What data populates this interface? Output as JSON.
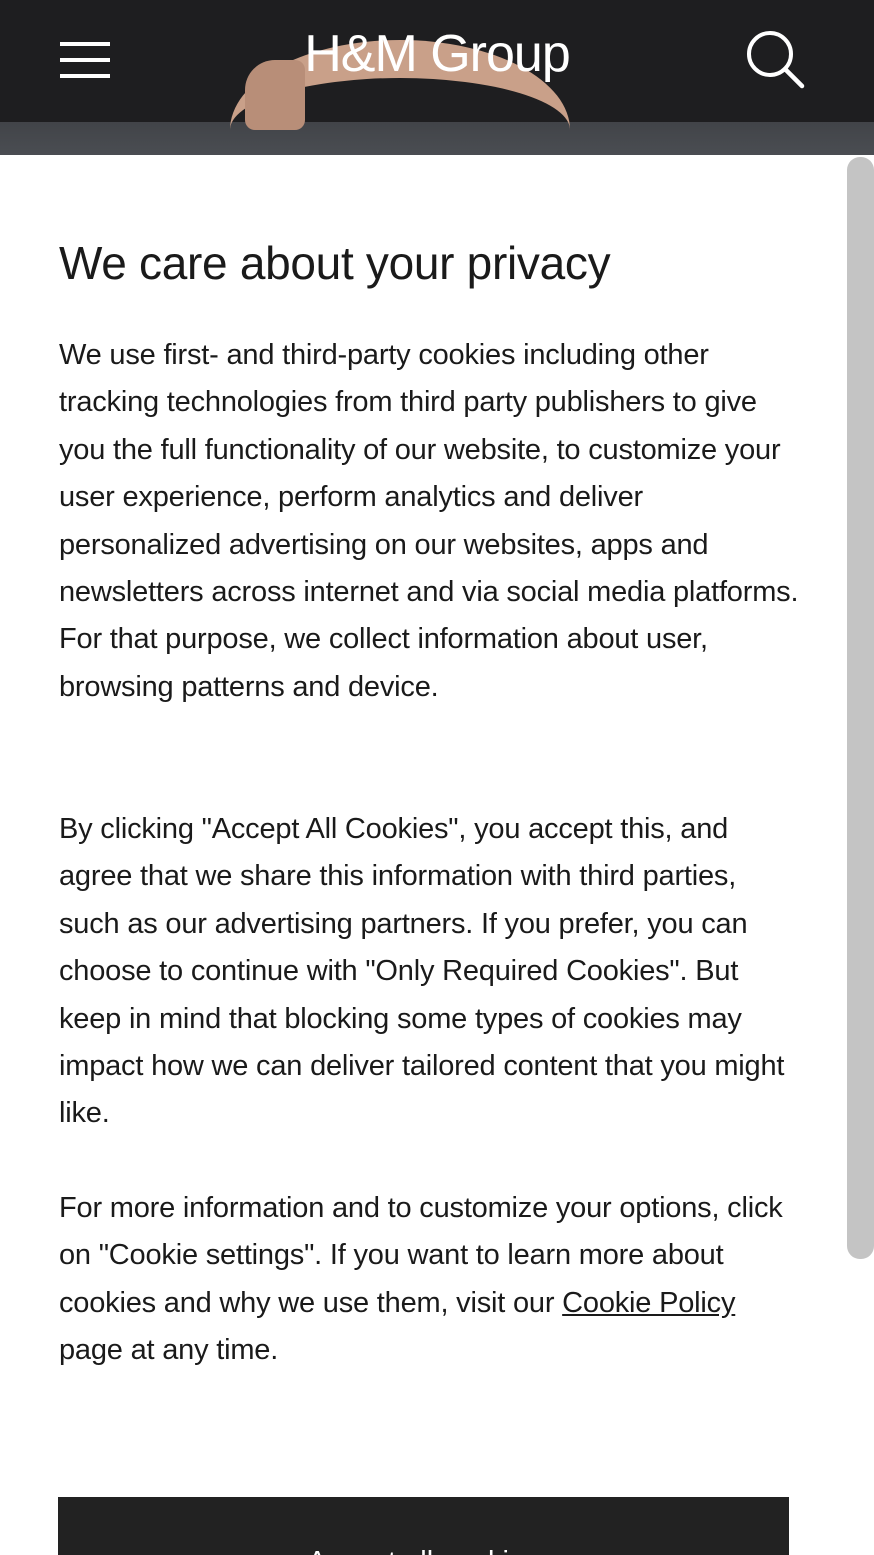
{
  "header": {
    "logo": "H&M Group",
    "menu_icon": "hamburger-menu-icon",
    "search_icon": "search-icon",
    "colors": {
      "band": "#1e1e20",
      "text": "#ffffff"
    }
  },
  "consent": {
    "title": "We care about your privacy",
    "paragraph_1": "We use first- and third-party cookies including other tracking technologies from third party publishers to give you the full functionality of our website, to customize your user experience, perform analytics and deliver personalized advertising on our websites, apps and newsletters across internet and via social media platforms. For that purpose, we collect information about user, browsing patterns and device.",
    "paragraph_2": "By clicking \"Accept All Cookies\", you accept this, and agree that we share this information with third parties, such as our advertising partners. If you prefer, you can choose to continue with \"Only Required Cookies\". But keep in mind that blocking some types of cookies may impact how we can deliver tailored content that you might like.",
    "paragraph_3_prefix": "For more information and to customize your options, click on \"Cookie settings\". If you want to learn more about cookies and why we use them, visit our ",
    "cookie_policy_link": "Cookie Policy",
    "paragraph_3_suffix": " page at any time.",
    "accept_button": "Accept all cookies",
    "colors": {
      "button_bg": "#222222",
      "text": "#1a1a1a",
      "scrollbar": "#c4c4c4"
    }
  }
}
